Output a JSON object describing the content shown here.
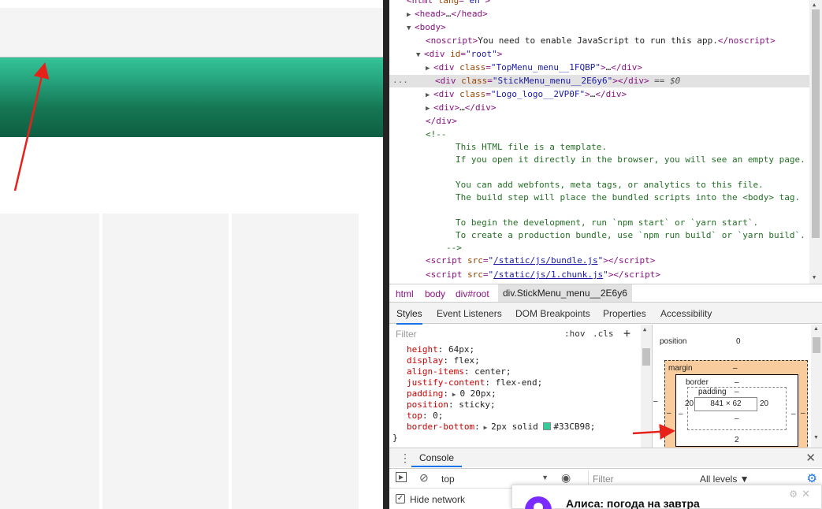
{
  "dom": {
    "lines": [
      {
        "t": "<html lang=\"en\">"
      },
      {
        "t": "<head>…</head>"
      },
      {
        "t": "<body>"
      },
      {
        "t": "<noscript>You need to enable JavaScript to run this app.</noscript>"
      },
      {
        "t": "<div id=\"root\">"
      },
      {
        "t": "<div class=\"TopMenu_menu__1FQBP\">…</div>"
      },
      {
        "t": "<div class=\"StickMenu_menu__2E6y6\"></div> == $0"
      },
      {
        "t": "<div class=\"Logo_logo__2VP0F\">…</div>"
      },
      {
        "t": "<div>…</div>"
      },
      {
        "t": "</div>"
      },
      {
        "t": "<!--"
      },
      {
        "t": "This HTML file is a template."
      },
      {
        "t": "If you open it directly in the browser, you will see an empty page."
      },
      {
        "t": ""
      },
      {
        "t": "You can add webfonts, meta tags, or analytics to this file."
      },
      {
        "t": "The build step will place the bundled scripts into the <body> tag."
      },
      {
        "t": ""
      },
      {
        "t": "To begin the development, run `npm start` or `yarn start`."
      },
      {
        "t": "To create a production bundle, use `npm run build` or `yarn build`."
      },
      {
        "t": "-->"
      },
      {
        "t": "/static/js/bundle.js"
      },
      {
        "t": "/static/js/1.chunk.js"
      }
    ],
    "selected_marker": "...",
    "selected_suffix": " == $0"
  },
  "breadcrumbs": [
    "html",
    "body",
    "div#root",
    "div.StickMenu_menu__2E6y6"
  ],
  "panel_tabs": [
    "Styles",
    "Event Listeners",
    "DOM Breakpoints",
    "Properties",
    "Accessibility"
  ],
  "styles": {
    "filter_placeholder": "Filter",
    "hov": ":hov",
    "cls": ".cls",
    "plus": "+",
    "rules": [
      {
        "prop": "height",
        "val": "64px;"
      },
      {
        "prop": "display",
        "val": "flex;"
      },
      {
        "prop": "align-items",
        "val": "center;"
      },
      {
        "prop": "justify-content",
        "val": "flex-end;"
      },
      {
        "prop": "padding",
        "val": "0 20px;"
      },
      {
        "prop": "position",
        "val": "sticky;"
      },
      {
        "prop": "top",
        "val": "0;"
      },
      {
        "prop": "border-bottom",
        "val": "2px solid #33CB98;"
      }
    ],
    "close_brace": "}",
    "swatch_color": "#33CB98"
  },
  "box_model": {
    "position_label": "position",
    "position_value": "0",
    "margin_label": "margin",
    "margin_top": "–",
    "margin_left": "–",
    "margin_right": "–",
    "margin_bottom": "–",
    "border_label": "border",
    "border_top": "–",
    "border_bottom": "2",
    "border_left": "–",
    "border_right": "–",
    "padding_label": "padding",
    "padding_top": "–",
    "padding_left": "20",
    "padding_right": "20",
    "padding_bottom": "–",
    "content": "841 × 62"
  },
  "drawer": {
    "tab": "Console",
    "context": "top",
    "filter_placeholder": "Filter",
    "levels": "All levels ▼",
    "hide_network": "Hide network"
  },
  "notification": {
    "title": "Алиса: погода на завтра"
  },
  "colors": {
    "accent": "#33CB98",
    "annotation": "#E8201A"
  }
}
